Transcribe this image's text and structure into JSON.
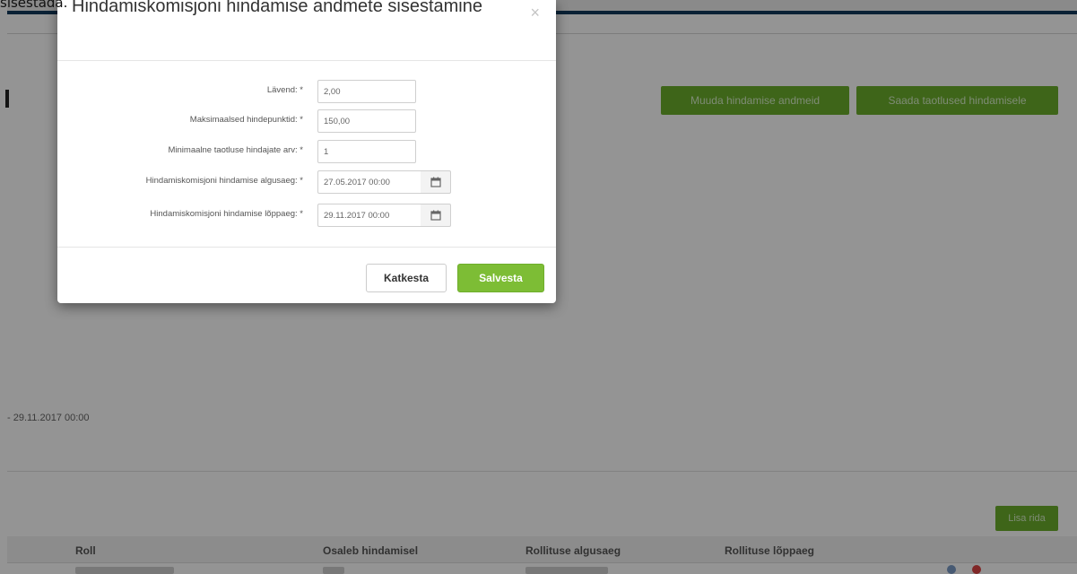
{
  "caption": "sisestada.",
  "background": {
    "actions": [
      {
        "label": "Muuda hindamise andmeid"
      },
      {
        "label": "Saada taotlused hindamisele"
      }
    ],
    "period_text": "- 29.11.2017 00:00",
    "add_button_label": "Lisa rida",
    "table": {
      "columns": [
        "Roll",
        "Osaleb hindamisel",
        "Rollituse algusaeg",
        "Rollituse lõppaeg"
      ]
    }
  },
  "modal": {
    "title": "Hindamiskomisjoni hindamise andmete sisestamine",
    "close_symbol": "×",
    "fields": [
      {
        "label": "Lävend:",
        "required": "*",
        "value": "2,00"
      },
      {
        "label": "Maksimaalsed hindepunktid:",
        "required": "*",
        "value": "150,00"
      },
      {
        "label": "Minimaalne taotluse hindajate arv:",
        "required": "*",
        "value": "1"
      },
      {
        "label": "Hindamiskomisjoni hindamise algusaeg:",
        "required": "*",
        "value": "27.05.2017 00:00"
      },
      {
        "label": "Hindamiskomisjoni hindamise lõppaeg:",
        "required": "*",
        "value": "29.11.2017 00:00"
      }
    ],
    "buttons": {
      "cancel": "Katkesta",
      "save": "Salvesta"
    }
  },
  "icons": {
    "calendar": "calendar-icon",
    "close": "close-icon"
  },
  "colors": {
    "primary_green": "#7dbd35",
    "header_navy": "#123a5c"
  }
}
